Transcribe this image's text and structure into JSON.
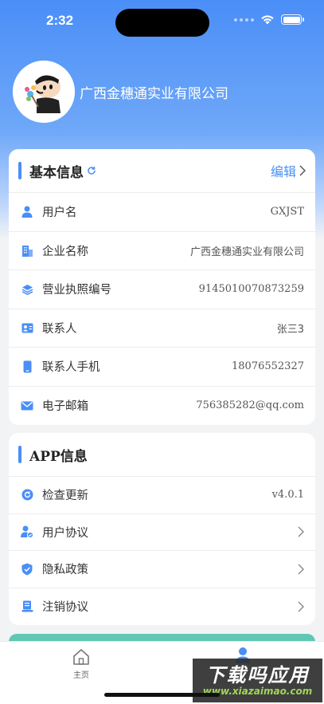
{
  "status_bar": {
    "time": "2:32"
  },
  "profile": {
    "company_name": "广西金穗通实业有限公司"
  },
  "basic_info": {
    "title": "基本信息",
    "edit_label": "编辑",
    "rows": [
      {
        "label": "用户名",
        "value": "GXJST"
      },
      {
        "label": "企业名称",
        "value": "广西金穗通实业有限公司"
      },
      {
        "label": "营业执照编号",
        "value": "9145010070873259"
      },
      {
        "label": "联系人",
        "value": "张三3"
      },
      {
        "label": "联系人手机",
        "value": "18076552327"
      },
      {
        "label": "电子邮箱",
        "value": "756385282@qq.com"
      }
    ]
  },
  "app_info": {
    "title": "APP信息",
    "rows": [
      {
        "label": "检查更新",
        "value": "v4.0.1"
      },
      {
        "label": "用户协议"
      },
      {
        "label": "隐私政策"
      },
      {
        "label": "注销协议"
      }
    ]
  },
  "tabbar": {
    "home_label": "主页"
  },
  "watermark": {
    "title": "下载吗应用",
    "url": "www.xiazaimao.com"
  },
  "colors": {
    "accent": "#4a8ef7",
    "teal": "#5fc8b3"
  }
}
